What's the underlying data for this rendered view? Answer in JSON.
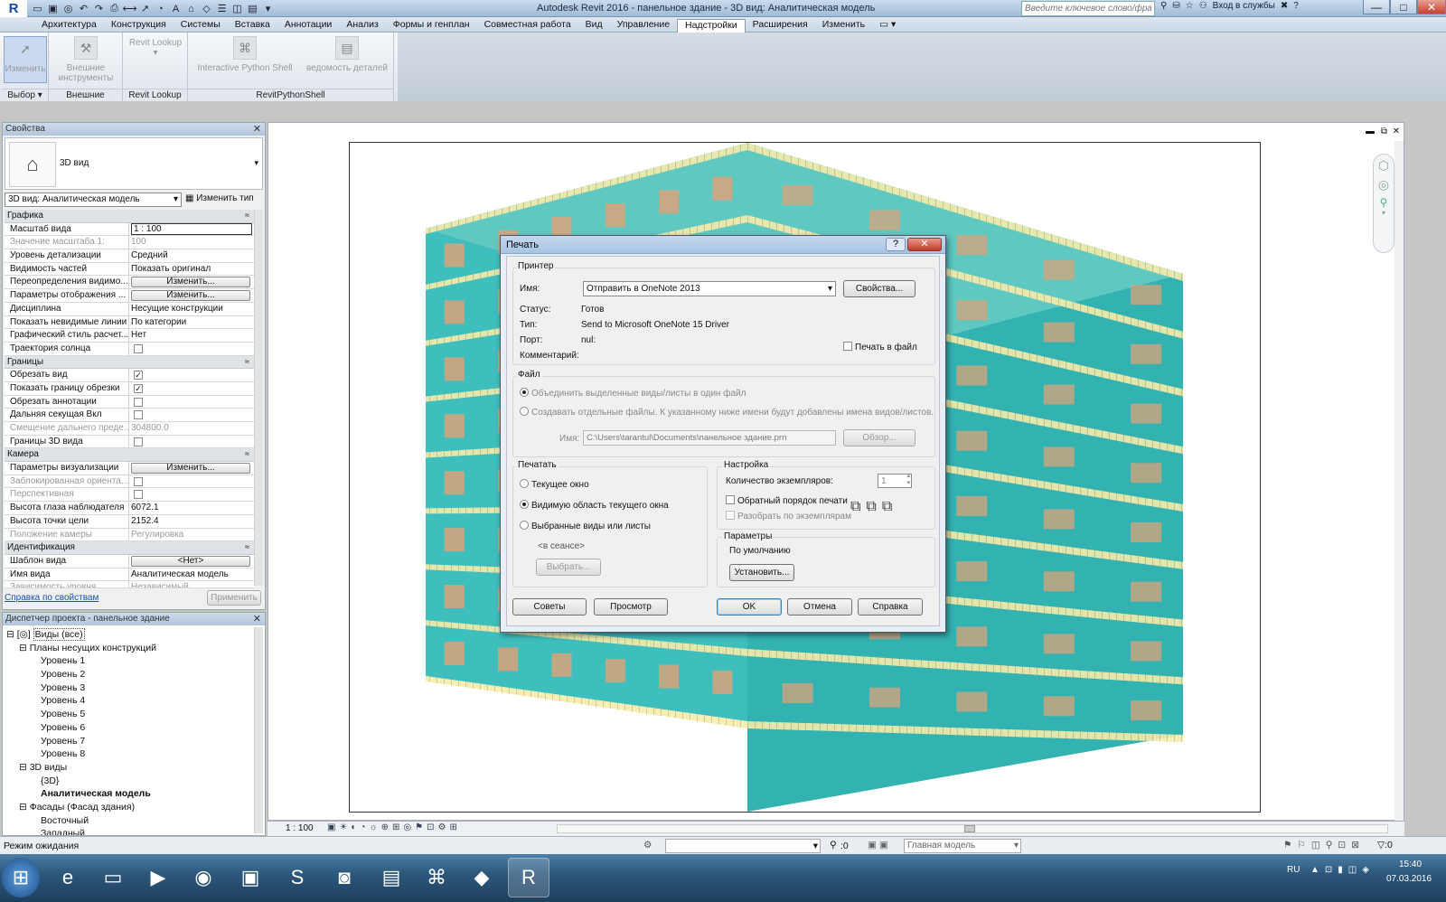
{
  "titlebar": {
    "app_title": "Autodesk Revit 2016 -    панельное здание - 3D вид: Аналитическая модель",
    "search_placeholder": "Введите ключевое слово/фразу",
    "signin_label": "Вход в службы",
    "minimize": "—",
    "maximize": "□",
    "close": "✕"
  },
  "menu": {
    "tabs": [
      "Архитектура",
      "Конструкция",
      "Системы",
      "Вставка",
      "Аннотации",
      "Анализ",
      "Формы и генплан",
      "Совместная работа",
      "Вид",
      "Управление",
      "Надстройки",
      "Расширения",
      "Изменить"
    ],
    "active_tab": "Надстройки"
  },
  "ribbon": {
    "modify": "Изменить",
    "select_panel": "Выбор",
    "ext_tools": "Внешние инструменты",
    "ext_panel": "Внешние",
    "revit_lookup_btn": "Revit Lookup",
    "revit_lookup_panel": "Revit Lookup",
    "python_shell": "Interactive Python Shell",
    "detail_sheet": "ведомость деталей",
    "python_panel": "RevitPythonShell"
  },
  "properties": {
    "title": "Свойства",
    "type_name": "3D вид",
    "view_selector": "3D вид: Аналитическая модель",
    "edit_type": "Изменить тип",
    "help_link": "Справка по свойствам",
    "apply_button": "Применить",
    "groups": {
      "graphics": "Графика",
      "extents": "Границы",
      "camera": "Камера",
      "identity": "Идентификация"
    },
    "rows": {
      "scale": {
        "n": "Масштаб вида",
        "v": "1 : 100"
      },
      "scale_value": {
        "n": "Значение масштаба    1:",
        "v": "100"
      },
      "detail_level": {
        "n": "Уровень детализации",
        "v": "Средний"
      },
      "parts_visibility": {
        "n": "Видимость частей",
        "v": "Показать оригинал"
      },
      "vg_overrides": {
        "n": "Переопределения видимо...",
        "v": "Изменить..."
      },
      "display_options": {
        "n": "Параметры отображения ...",
        "v": "Изменить..."
      },
      "discipline": {
        "n": "Дисциплина",
        "v": "Несущие конструкции"
      },
      "hidden_lines": {
        "n": "Показать невидимые линии",
        "v": "По категории"
      },
      "analysis_style": {
        "n": "Графический стиль расчет...",
        "v": "Нет"
      },
      "sun_path": {
        "n": "Траектория солнца",
        "v": ""
      },
      "crop_view": {
        "n": "Обрезать вид",
        "v": "✓"
      },
      "crop_region": {
        "n": "Показать границу обрезки",
        "v": "✓"
      },
      "annotation_crop": {
        "n": "Обрезать аннотации",
        "v": ""
      },
      "far_clip": {
        "n": "Дальняя секущая Вкл",
        "v": ""
      },
      "far_clip_offset": {
        "n": "Смещение дальнего преде...",
        "v": "304800.0"
      },
      "section_box": {
        "n": "Границы 3D вида",
        "v": ""
      },
      "render_settings": {
        "n": "Параметры визуализации",
        "v": "Изменить..."
      },
      "locked_orient": {
        "n": "Заблокированная ориента...",
        "v": ""
      },
      "perspective": {
        "n": "Перспективная",
        "v": ""
      },
      "eye_elevation": {
        "n": "Высота глаза наблюдателя",
        "v": "6072.1"
      },
      "target_elevation": {
        "n": "Высота точки цели",
        "v": "2152.4"
      },
      "camera_position": {
        "n": "Положение камеры",
        "v": "Регулировка"
      },
      "view_template": {
        "n": "Шаблон вида",
        "v": "<Нет>"
      },
      "view_name": {
        "n": "Имя вида",
        "v": "Аналитическая модель"
      },
      "dependency": {
        "n": "Зависимость уровня",
        "v": "Независимый"
      }
    }
  },
  "browser": {
    "title": "Диспетчер проекта - панельное здание",
    "items": {
      "views_all": "Виды (все)",
      "plans": "Планы несущих конструкций",
      "l1": "Уровень 1",
      "l2": "Уровень 2",
      "l3": "Уровень 3",
      "l4": "Уровень 4",
      "l5": "Уровень 5",
      "l6": "Уровень 6",
      "l7": "Уровень 7",
      "l8": "Уровень 8",
      "views3d": "3D виды",
      "v3d": "{3D}",
      "analytic": "Аналитическая модель",
      "elevations": "Фасады (Фасад здания)",
      "east": "Восточный",
      "west": "Западный"
    }
  },
  "viewbar": {
    "scale": "1 : 100"
  },
  "statusbar": {
    "status": "Режим ожидания",
    "count": ":0",
    "model": "Главная модель"
  },
  "taskbar": {
    "lang": "RU",
    "time": "15:40",
    "date": "07.03.2016"
  },
  "print_dialog": {
    "title": "Печать",
    "help_glyph": "?",
    "close_glyph": "✕",
    "printer_group": "Принтер",
    "name_label": "Имя:",
    "printer_name": "Отправить в OneNote 2013",
    "properties_button": "Свойства...",
    "status_label": "Статус:",
    "status_value": "Готов",
    "type_label": "Тип:",
    "type_value": "Send to Microsoft OneNote 15 Driver",
    "port_label": "Порт:",
    "port_value": "nul:",
    "comment_label": "Комментарий:",
    "print_to_file": "Печать в файл",
    "file_group": "Файл",
    "combine_files": "Объединить выделенные виды/листы в один файл",
    "separate_files": "Создавать отдельные файлы. К указанному ниже имени будут добавлены имена видов/листов.",
    "file_name_label": "Имя:",
    "file_path": "C:\\Users\\tarantul\\Documents\\панельное здание.prn",
    "browse_button": "Обзор...",
    "range_group": "Печатать",
    "current_window": "Текущее окно",
    "visible_portion": "Видимую область текущего окна",
    "selected_views": "Выбранные виды или листы",
    "in_session": "<в сеансе>",
    "select_button": "Выбрать...",
    "options_group": "Настройка",
    "copies_label": "Количество экземпляров:",
    "copies_value": "1",
    "reverse_order": "Обратный порядок печати",
    "collate": "Разобрать по экземплярам",
    "settings_group": "Параметры",
    "settings_value": "По умолчанию",
    "setup_button": "Установить...",
    "tips_button": "Советы",
    "preview_button": "Просмотр",
    "ok_button": "OK",
    "cancel_button": "Отмена",
    "help_button": "Справка"
  },
  "colors": {
    "model_teal": "#2fb8b8",
    "model_window": "#d9a37a",
    "slab_edge": "#d8c23a"
  }
}
